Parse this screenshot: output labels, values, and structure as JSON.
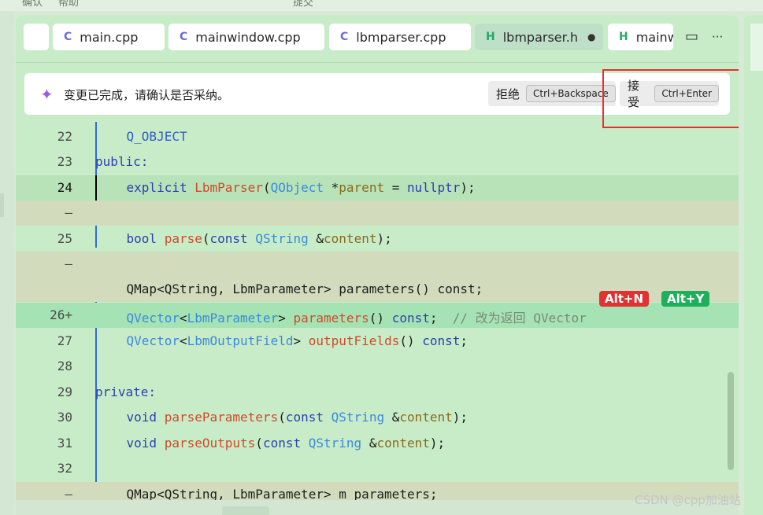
{
  "topstrip": {
    "items": [
      "确认",
      "帮助",
      "提交"
    ]
  },
  "tabs": [
    {
      "label": "main.cpp",
      "icon": "cpp-file-icon",
      "active": false
    },
    {
      "label": "mainwindow.cpp",
      "icon": "cpp-file-icon",
      "active": false
    },
    {
      "label": "lbmparser.cpp",
      "icon": "cpp-file-icon",
      "active": false
    },
    {
      "label": "lbmparser.h",
      "icon": "header-file-icon",
      "active": true,
      "modified": true
    },
    {
      "label": "mainw",
      "icon": "header-file-icon",
      "active": false
    }
  ],
  "tab_icons": {
    "cpp": "C",
    "h": "H",
    "modified_dot": "●"
  },
  "toolbar": {
    "split_glyph": "▭",
    "more_glyph": "···"
  },
  "notice": {
    "spark_glyph": "✦",
    "message": "变更已完成，请确认是否采纳。",
    "reject_label": "拒绝",
    "reject_key": "Ctrl+Backspace",
    "accept_label": "接受",
    "accept_key": "Ctrl+Enter"
  },
  "badges": {
    "reject": "Alt+N",
    "accept": "Alt+Y"
  },
  "code": {
    "lines": [
      {
        "num": "22",
        "kind": "normal"
      },
      {
        "num": "23",
        "kind": "normal"
      },
      {
        "num": "24",
        "kind": "current"
      },
      {
        "num": "—",
        "kind": "deleted"
      },
      {
        "num": "25",
        "kind": "normal"
      },
      {
        "num": "—",
        "kind": "deleted"
      },
      {
        "num": "",
        "kind": "deleted"
      },
      {
        "num": "26+",
        "kind": "added"
      },
      {
        "num": "27",
        "kind": "normal"
      },
      {
        "num": "28",
        "kind": "normal"
      },
      {
        "num": "29",
        "kind": "normal"
      },
      {
        "num": "30",
        "kind": "normal"
      },
      {
        "num": "31",
        "kind": "normal"
      },
      {
        "num": "32",
        "kind": "normal"
      },
      {
        "num": "—",
        "kind": "deleted"
      }
    ],
    "tokens": {
      "l22": [
        "    ",
        "Q_OBJECT"
      ],
      "l23": [
        "public:"
      ],
      "l24": [
        "    ",
        "explicit",
        " ",
        "LbmParser",
        "(",
        "QObject",
        " *",
        "parent",
        " = ",
        "nullptr",
        ");"
      ],
      "l25": [
        "    ",
        "bool",
        " ",
        "parse",
        "(",
        "const",
        " ",
        "QString",
        " &",
        "content",
        ");"
      ],
      "ldel": [
        "    QMap<QString, LbmParameter> parameters() const;"
      ],
      "l26": [
        "    ",
        "QVector",
        "<",
        "LbmParameter",
        "> ",
        "parameters",
        "() ",
        "const",
        ";  ",
        "// 改为返回 QVector"
      ],
      "l27": [
        "    ",
        "QVector",
        "<",
        "LbmOutputField",
        "> ",
        "outputFields",
        "() ",
        "const",
        ";"
      ],
      "l29": [
        "private:"
      ],
      "l30": [
        "    ",
        "void",
        " ",
        "parseParameters",
        "(",
        "const",
        " ",
        "QString",
        " &",
        "content",
        ");"
      ],
      "l31": [
        "    ",
        "void",
        " ",
        "parseOutputs",
        "(",
        "const",
        " ",
        "QString",
        " &",
        "content",
        ");"
      ],
      "ldel2": [
        "    QMap<QString, LbmParameter> m_parameters;"
      ]
    }
  },
  "watermark": "CSDN @cpp加油站",
  "colors": {
    "background": "#c8ecc8",
    "added_line": "#a6e3b4",
    "deleted_line": "#d2dcbd",
    "reject_badge": "#e13232",
    "accept_badge": "#1fae5a",
    "highlight_frame": "#e53030"
  }
}
